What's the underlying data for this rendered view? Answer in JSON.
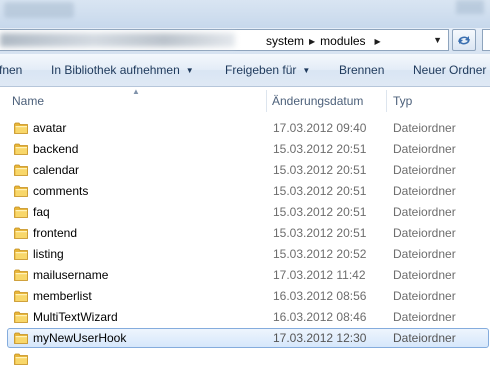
{
  "address": {
    "crumbs": [
      "system",
      "modules"
    ],
    "separator": "▶",
    "dropdown_icon": "chevron-down-icon",
    "refresh_icon": "refresh-icon"
  },
  "toolbar": {
    "organize_partial": "fnen",
    "library_label": "In Bibliothek aufnehmen",
    "share_label": "Freigeben für",
    "burn_label": "Brennen",
    "new_folder_label": "Neuer Ordner"
  },
  "columns": {
    "name": "Name",
    "modified": "Änderungsdatum",
    "type": "Typ"
  },
  "files": [
    {
      "name": "avatar",
      "modified": "17.03.2012 09:40",
      "type": "Dateiordner"
    },
    {
      "name": "backend",
      "modified": "15.03.2012 20:51",
      "type": "Dateiordner"
    },
    {
      "name": "calendar",
      "modified": "15.03.2012 20:51",
      "type": "Dateiordner"
    },
    {
      "name": "comments",
      "modified": "15.03.2012 20:51",
      "type": "Dateiordner"
    },
    {
      "name": "faq",
      "modified": "15.03.2012 20:51",
      "type": "Dateiordner"
    },
    {
      "name": "frontend",
      "modified": "15.03.2012 20:51",
      "type": "Dateiordner"
    },
    {
      "name": "listing",
      "modified": "15.03.2012 20:52",
      "type": "Dateiordner"
    },
    {
      "name": "mailusername",
      "modified": "17.03.2012 11:42",
      "type": "Dateiordner"
    },
    {
      "name": "memberlist",
      "modified": "16.03.2012 08:56",
      "type": "Dateiordner"
    },
    {
      "name": "MultiTextWizard",
      "modified": "16.03.2012 08:46",
      "type": "Dateiordner"
    },
    {
      "name": "myNewUserHook",
      "modified": "17.03.2012 12:30",
      "type": "Dateiordner",
      "selected": true
    },
    {
      "name": "",
      "modified": "",
      "type": ""
    }
  ],
  "colors": {
    "command_text": "#1e395b",
    "header_text": "#4c607a",
    "selection_border": "#84acdd",
    "folder_yellow": "#f2c74a"
  }
}
